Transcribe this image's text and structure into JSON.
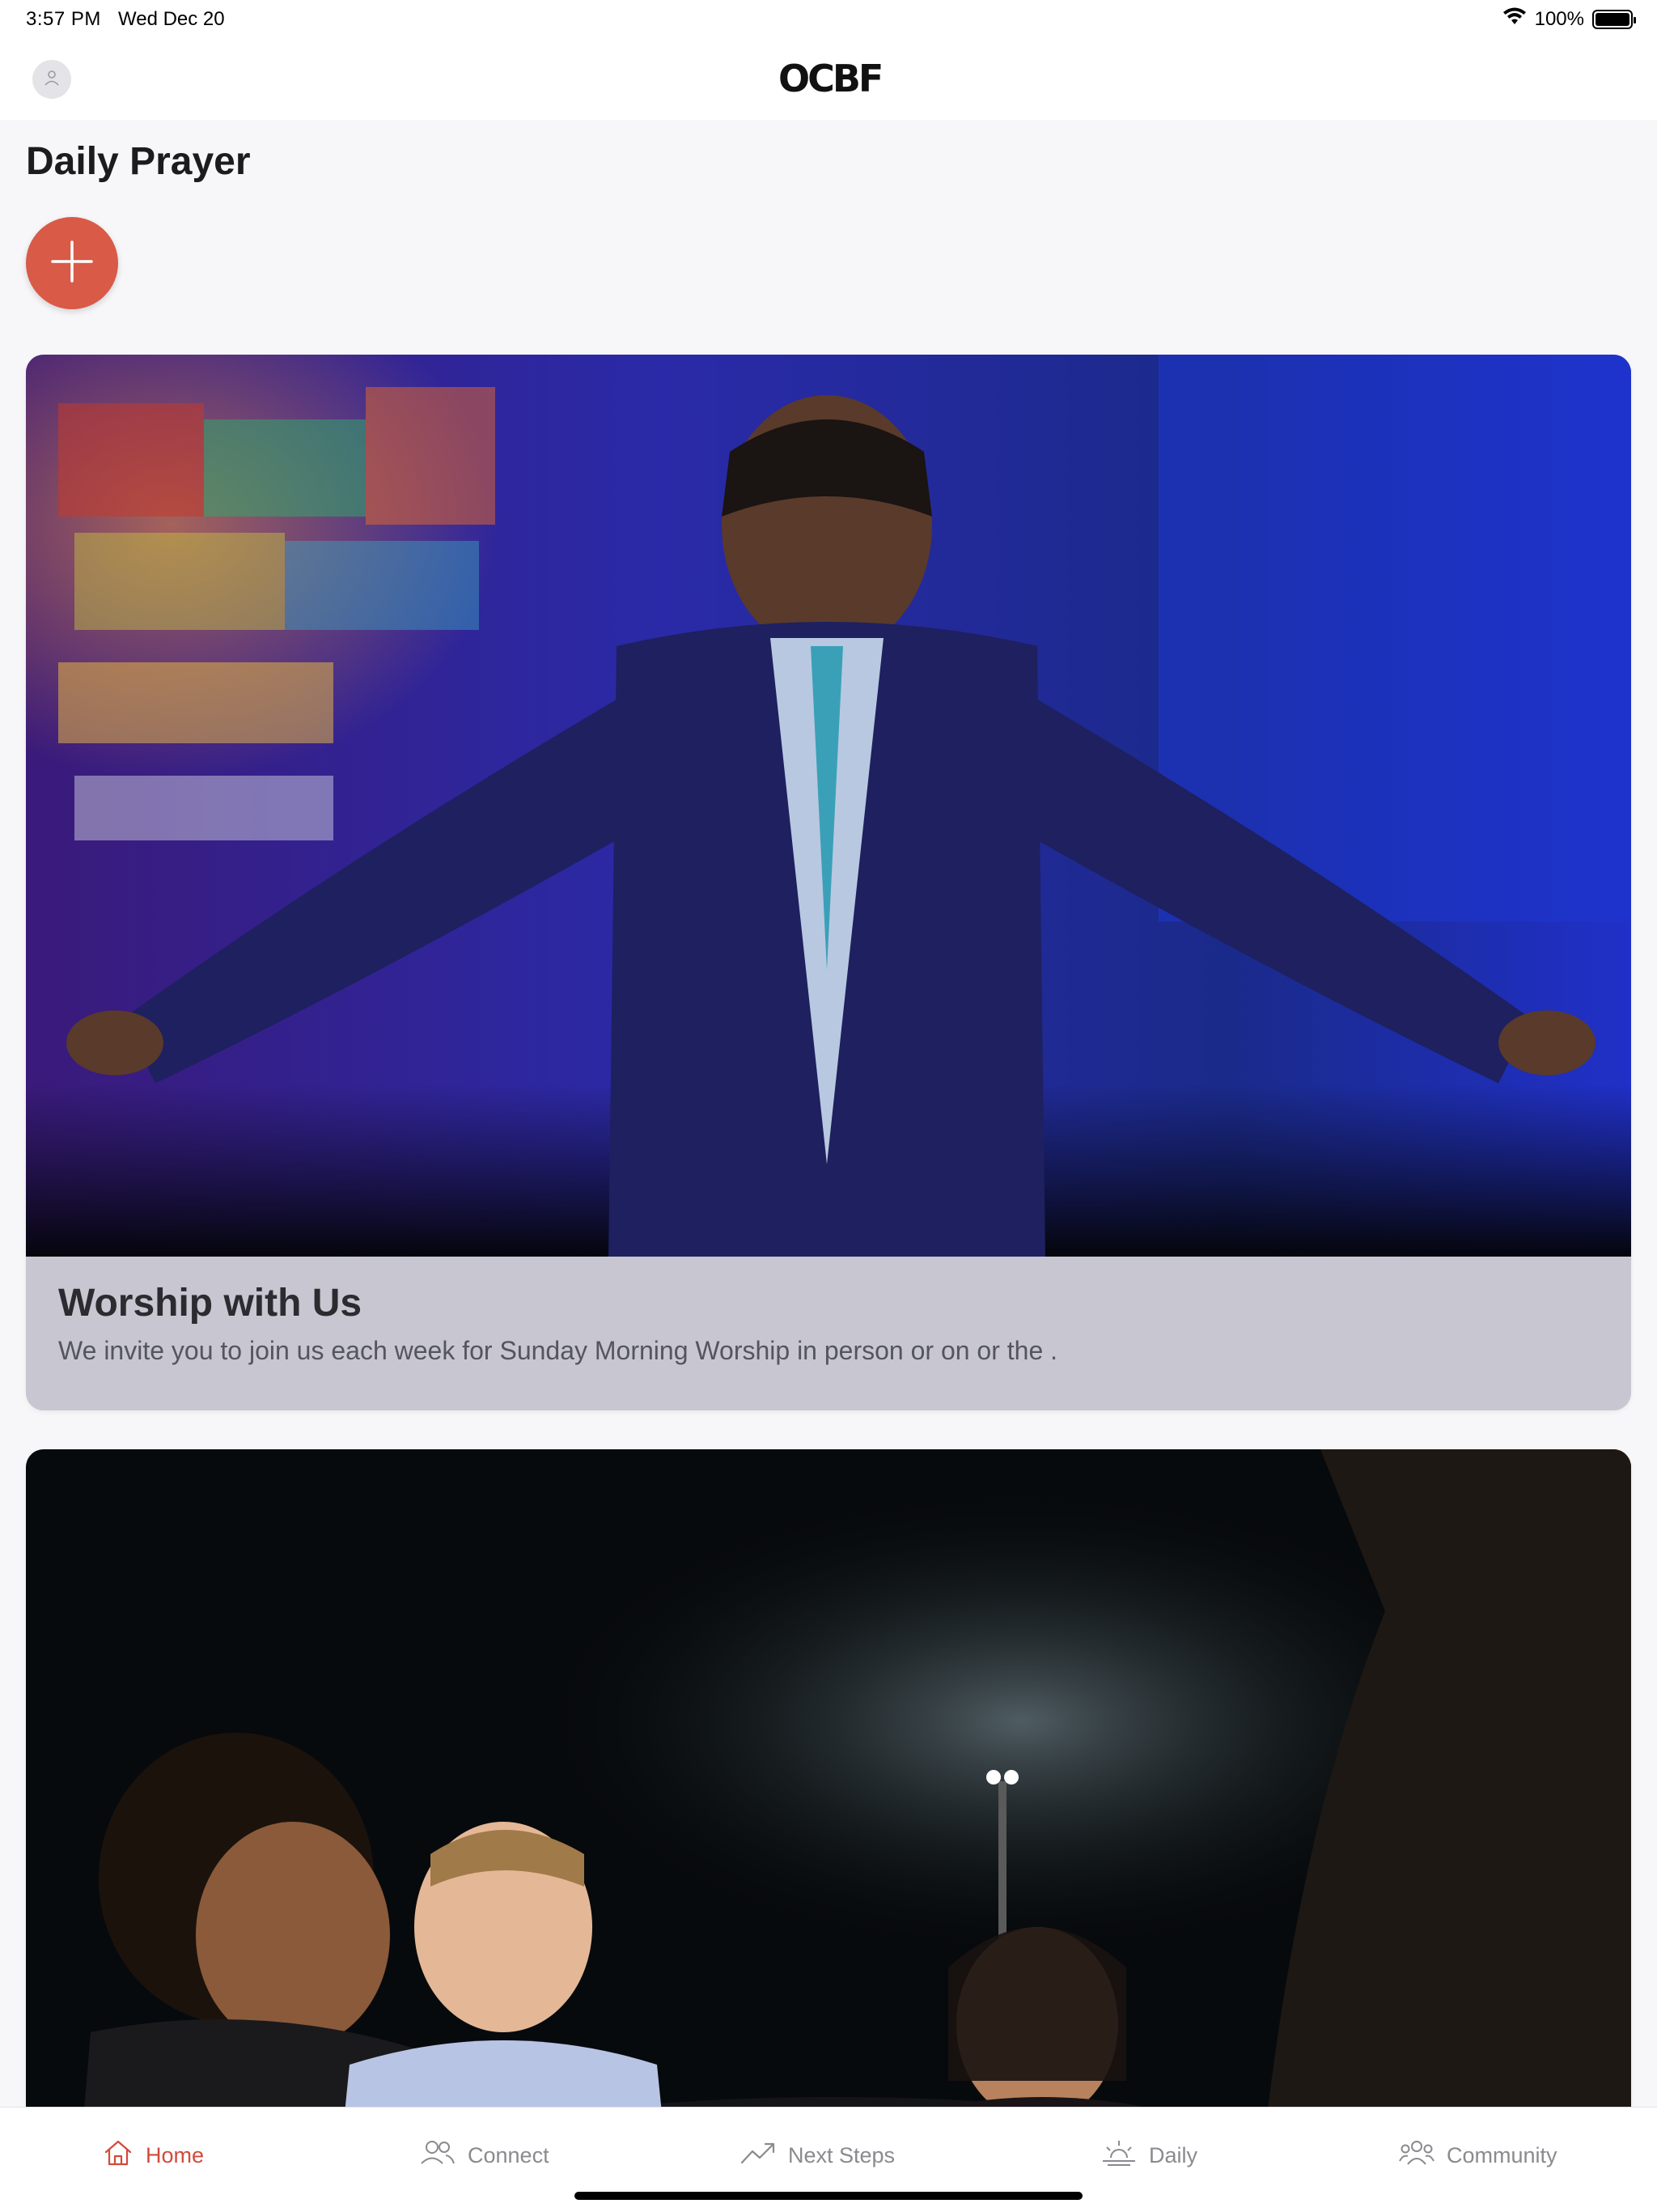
{
  "status_bar": {
    "time": "3:57 PM",
    "date": "Wed Dec 20",
    "battery_percent_label": "100%",
    "battery_level": 1.0,
    "icons": [
      "wifi-icon",
      "battery-icon"
    ]
  },
  "nav": {
    "logo_text": "OCBF",
    "avatar_icon": "person-icon"
  },
  "page": {
    "title": "Daily Prayer",
    "add_button_icon": "plus-icon",
    "accent_color": "#d85a47"
  },
  "cards": [
    {
      "title": "Worship with Us",
      "description": "We invite you to join us each week for Sunday Morning Worship in person or on or the ."
    },
    {
      "title": "",
      "description": ""
    }
  ],
  "tab_bar": {
    "active_color": "#d24a3a",
    "inactive_color": "#8a8a8f",
    "tabs": [
      {
        "label": "Home",
        "icon": "home-icon",
        "active": true
      },
      {
        "label": "Connect",
        "icon": "people-icon",
        "active": false
      },
      {
        "label": "Next Steps",
        "icon": "trending-up-icon",
        "active": false
      },
      {
        "label": "Daily",
        "icon": "sunrise-icon",
        "active": false
      },
      {
        "label": "Community",
        "icon": "group-icon",
        "active": false
      }
    ]
  }
}
